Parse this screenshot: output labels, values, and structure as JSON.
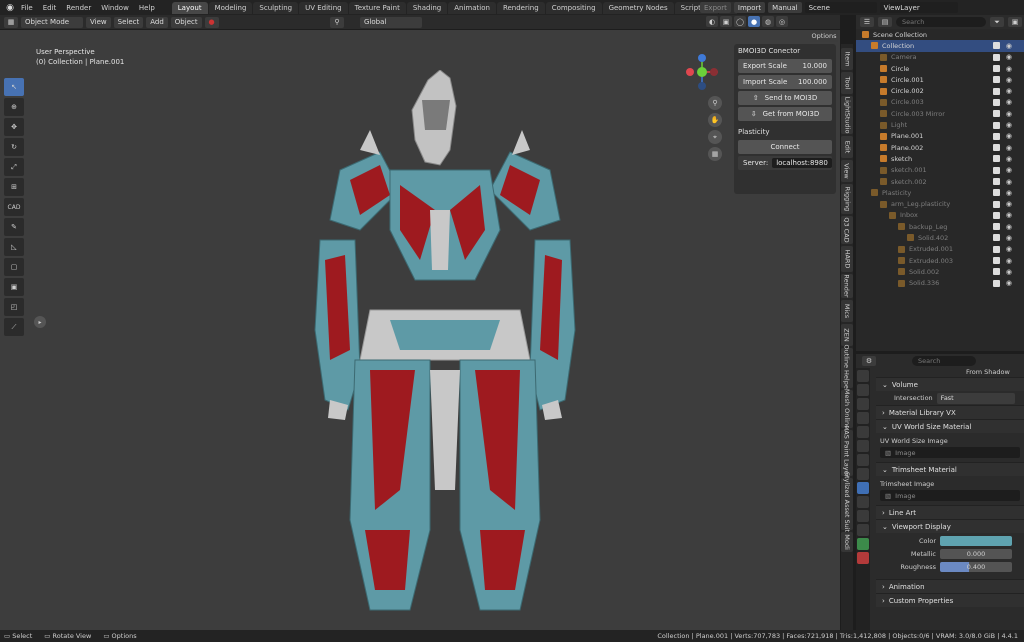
{
  "menu": [
    "File",
    "Edit",
    "Render",
    "Window",
    "Help"
  ],
  "workspaces": [
    "Layout",
    "Modeling",
    "Sculpting",
    "UV Editing",
    "Texture Paint",
    "Shading",
    "Animation",
    "Rendering",
    "Compositing",
    "Geometry Nodes",
    "Scripting"
  ],
  "active_workspace": "Layout",
  "top_right": {
    "export": "Export",
    "import": "Import",
    "manual": "Manual",
    "scene": "Scene",
    "viewlayer": "ViewLayer"
  },
  "header": {
    "mode": "Object Mode",
    "view": "View",
    "select": "Select",
    "add": "Add",
    "object": "Object",
    "orientation": "Global",
    "options": "Options"
  },
  "viewport": {
    "perspective": "User Perspective",
    "collection": "(0) Collection | Plane.001"
  },
  "npanel": {
    "title": "BMOI3D Conector",
    "export_label": "Export Scale",
    "export_value": "10.000",
    "import_label": "Import Scale",
    "import_value": "100.000",
    "send": "Send to MOI3D",
    "get": "Get from MOI3D",
    "plasticity_title": "Plasticity",
    "connect": "Connect",
    "server_label": "Server:",
    "server_value": "localhost:8980"
  },
  "vtabs": [
    "Item",
    "Tool",
    "LightStudio",
    "Edit",
    "View",
    "Rigging",
    "Q3 CAD",
    "HARD",
    "Render",
    "Mics",
    "ZEN",
    "Outline Helper",
    "Mesh Online",
    "HAS Paint Layers",
    "Stylized Asset Suite",
    "Modi"
  ],
  "outliner": {
    "search": "Search",
    "items": [
      {
        "label": "Scene Collection",
        "indent": 0,
        "dim": false,
        "sel": false
      },
      {
        "label": "Collection",
        "indent": 1,
        "dim": false,
        "sel": true
      },
      {
        "label": "Camera",
        "indent": 2,
        "dim": true,
        "sel": false
      },
      {
        "label": "Circle",
        "indent": 2,
        "dim": false,
        "sel": false
      },
      {
        "label": "Circle.001",
        "indent": 2,
        "dim": false,
        "sel": false
      },
      {
        "label": "Circle.002",
        "indent": 2,
        "dim": false,
        "sel": false
      },
      {
        "label": "Circle.003",
        "indent": 2,
        "dim": true,
        "sel": false
      },
      {
        "label": "Circle.003 Mirror",
        "indent": 2,
        "dim": true,
        "sel": false
      },
      {
        "label": "Light",
        "indent": 2,
        "dim": true,
        "sel": false
      },
      {
        "label": "Plane.001",
        "indent": 2,
        "dim": false,
        "sel": false
      },
      {
        "label": "Plane.002",
        "indent": 2,
        "dim": false,
        "sel": false
      },
      {
        "label": "sketch",
        "indent": 2,
        "dim": false,
        "sel": false
      },
      {
        "label": "sketch.001",
        "indent": 2,
        "dim": true,
        "sel": false
      },
      {
        "label": "sketch.002",
        "indent": 2,
        "dim": true,
        "sel": false
      },
      {
        "label": "Plasticity",
        "indent": 1,
        "dim": true,
        "sel": false
      },
      {
        "label": "arm_Leg.plasticity",
        "indent": 2,
        "dim": true,
        "sel": false
      },
      {
        "label": "Inbox",
        "indent": 3,
        "dim": true,
        "sel": false
      },
      {
        "label": "backup_Leg",
        "indent": 4,
        "dim": true,
        "sel": false
      },
      {
        "label": "Solid.402",
        "indent": 5,
        "dim": true,
        "sel": false
      },
      {
        "label": "Extruded.001",
        "indent": 4,
        "dim": true,
        "sel": false
      },
      {
        "label": "Extruded.003",
        "indent": 4,
        "dim": true,
        "sel": false
      },
      {
        "label": "Solid.002",
        "indent": 4,
        "dim": true,
        "sel": false
      },
      {
        "label": "Solid.336",
        "indent": 4,
        "dim": true,
        "sel": false
      }
    ]
  },
  "properties": {
    "search": "Search",
    "from_shadow": "From Shadow",
    "volume": "Volume",
    "intersection_label": "Intersection",
    "intersection_value": "Fast",
    "material_library": "Material Library VX",
    "uv_world": "UV World Size Material",
    "uv_world_image": "UV World Size Image",
    "image_placeholder": "Image",
    "trimsheet": "Trimsheet Material",
    "trimsheet_image": "Trimsheet Image",
    "line_art": "Line Art",
    "viewport_display": "Viewport Display",
    "color_label": "Color",
    "color_value": "#5fa3b0",
    "metallic_label": "Metallic",
    "metallic_value": "0.000",
    "roughness_label": "Roughness",
    "roughness_value": "0.400",
    "animation": "Animation",
    "custom_props": "Custom Properties"
  },
  "status": {
    "select": "Select",
    "rotate": "Rotate View",
    "options": "Options",
    "stats": "Collection | Plane.001 | Verts:707,783 | Faces:721,918 | Tris:1,412,808 | Objects:0/6 | VRAM: 3.0/8.0 GiB | 4.4.1"
  },
  "colors": {
    "teal": "#5e9aa6",
    "red": "#9e1a1f",
    "silver": "#c8c8c8",
    "accent": "#4772b3"
  }
}
